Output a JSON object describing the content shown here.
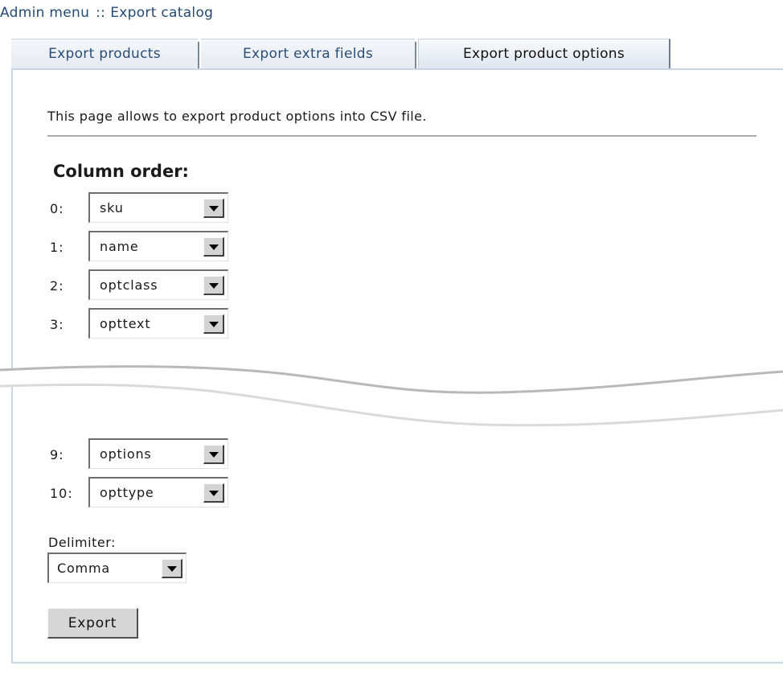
{
  "breadcrumb": {
    "root": "Admin menu",
    "separator": "::",
    "current": "Export catalog"
  },
  "tabs": [
    {
      "label": "Export products",
      "active": false
    },
    {
      "label": "Export extra fields",
      "active": false
    },
    {
      "label": "Export product options",
      "active": true
    }
  ],
  "intro_text": "This page allows to export product options into CSV file.",
  "column_order": {
    "heading": "Column order:",
    "rows": [
      {
        "index": "0:",
        "value": "sku"
      },
      {
        "index": "1:",
        "value": "name"
      },
      {
        "index": "2:",
        "value": "optclass"
      },
      {
        "index": "3:",
        "value": "opttext"
      },
      {
        "index": "9:",
        "value": "options"
      },
      {
        "index": "10:",
        "value": "opttype"
      }
    ]
  },
  "delimiter": {
    "label": "Delimiter:",
    "value": "Comma"
  },
  "export_button": "Export",
  "colors": {
    "link": "#234b77",
    "panel_border": "#c9d6e3",
    "tab_bg": "#e6ebf1"
  }
}
